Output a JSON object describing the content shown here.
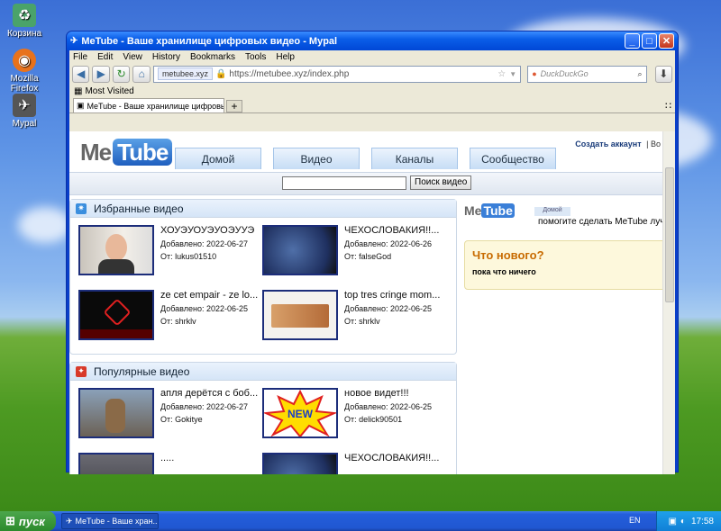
{
  "desktop": {
    "icons": [
      {
        "label": "Корзина",
        "glyph": "♻"
      },
      {
        "label": "Mozilla Firefox",
        "glyph": "◉"
      },
      {
        "label": "Mypal",
        "glyph": "✈"
      }
    ]
  },
  "window": {
    "title": "MeTube - Ваше хранилище цифровых видео - Mypal",
    "controls": {
      "minimize": "_",
      "maximize": "□",
      "close": "✕"
    }
  },
  "menu": [
    "File",
    "Edit",
    "View",
    "History",
    "Bookmarks",
    "Tools",
    "Help"
  ],
  "toolbar": {
    "domain": "metubee.xyz",
    "url": "https://metubee.xyz/index.php",
    "search_placeholder": "DuckDuckGo"
  },
  "bookmarks": {
    "most_visited": "Most Visited"
  },
  "tab": {
    "title": "MeTube - Ваше хранилище цифровых видео",
    "new_tab": "+"
  },
  "site": {
    "logo_me": "Me",
    "logo_tube": "Tube",
    "nav": [
      "Домой",
      "Видео",
      "Каналы",
      "Сообщество"
    ],
    "account_link": "Создать аккаунт",
    "account_sep": "| Во",
    "search_button": "Поиск видео",
    "sections": {
      "featured_title": "Избранные видео",
      "popular_title": "Популярные видео"
    },
    "featured": [
      {
        "title": "ХОУЭУОУЭУОЭУУЭ",
        "added": "Добавлено: 2022-06-27",
        "from": "От: lukus01510"
      },
      {
        "title": "ЧЕХОСЛОВАКИЯ!!...",
        "added": "Добавлено: 2022-06-26",
        "from": "От: falseGod"
      },
      {
        "title": "ze cet empair - ze lo...",
        "added": "Добавлено: 2022-06-25",
        "from": "От: shrklv"
      },
      {
        "title": "top tres cringe mom...",
        "added": "Добавлено: 2022-06-25",
        "from": "От: shrklv"
      }
    ],
    "popular": [
      {
        "title": "апля дерётся с боб...",
        "added": "Добавлено: 2022-06-27",
        "from": "От: Gokitye"
      },
      {
        "title": "новое видет!!!",
        "added": "Добавлено: 2022-06-25",
        "from": "От: delick90501"
      },
      {
        "title": ".....",
        "added": "",
        "from": ""
      },
      {
        "title": "ЧЕХОСЛОВАКИЯ!!...",
        "added": "",
        "from": ""
      }
    ],
    "sidebar": {
      "tab_label": "Домой",
      "promo": "помогите сделать MeTube лучше",
      "news_title": "Что нового?",
      "news_text": "пока что ничего"
    }
  },
  "taskbar": {
    "start": "пуск",
    "task": "MeTube - Ваше хран...",
    "lang": "EN",
    "time": "17:58"
  }
}
